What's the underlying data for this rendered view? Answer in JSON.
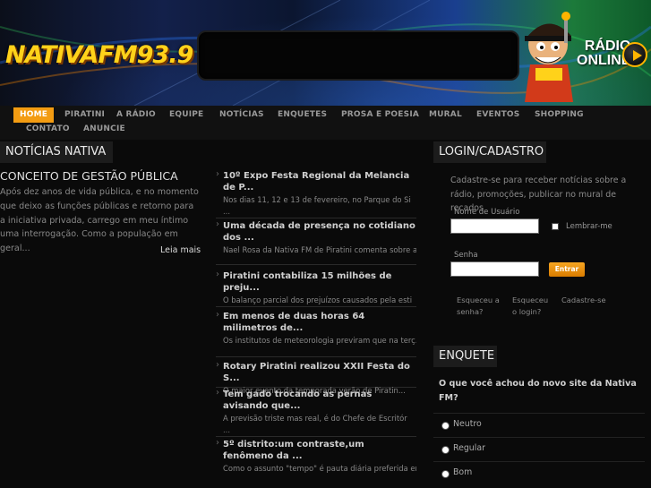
{
  "header": {
    "logo_text": "NATIVAFM93.9",
    "radio_online_line1": "RÁDIO",
    "radio_online_line2": "ONLINE"
  },
  "nav": {
    "items": [
      "HOME",
      "PIRATINI",
      "A RÁDIO",
      "EQUIPE",
      "NOTÍCIAS",
      "ENQUETES",
      "PROSA E POESIA",
      "MURAL",
      "EVENTOS",
      "SHOPPING",
      "CONTATO",
      "ANUNCIE"
    ],
    "active": "HOME"
  },
  "noticias": {
    "section_title": "NOTÍCIAS NATIVA",
    "featured": {
      "title": "CONCEITO DE GESTÃO PÚBLICA",
      "text": "Após dez anos de vida pública, e no momento que deixo as funções públicas e retorno para a iniciativa privada, carrego em meu íntimo uma interrogação. Como a população em geral...",
      "read_more": "Leia mais"
    },
    "items": [
      {
        "title": "10º Expo Festa Regional da Melancia de P...",
        "snippet": "Nos dias 11, 12 e 13 de fevereiro, no Parque do Si",
        "ellipsis": "..."
      },
      {
        "title": "Uma década de presença no cotidiano dos ...",
        "snippet": "Nael Rosa da Nativa FM de Piratini comenta sobre a...",
        "ellipsis": ""
      },
      {
        "title": "Piratini contabiliza 15 milhões de preju...",
        "snippet": "O balanço parcial dos prejuízos causados pela esti",
        "ellipsis": "..."
      },
      {
        "title": "Em menos de duas horas 64 milimetros de...",
        "snippet": "Os institutos de meteorologia previram que na terç...",
        "ellipsis": ""
      },
      {
        "title": "Rotary Piratini realizou XXII Festa do S...",
        "snippet": "O  maior evento da temporada verão de Piratin...",
        "ellipsis": ""
      },
      {
        "title": "Tem gado trocando as pernas avisando que...",
        "snippet": "A previsão triste mas real, é do Chefe de Escritór",
        "ellipsis": "..."
      },
      {
        "title": "5º distrito:um contraste,um fenômeno da ...",
        "snippet": "Como o assunto \"tempo\" é pauta diária preferida ent...",
        "ellipsis": ""
      }
    ]
  },
  "login": {
    "section_title": "LOGIN/CADASTRO",
    "intro": "Cadastre-se para receber notícias sobre a rádio, promoções, publicar no mural de recados",
    "username_label": "Nome de Usuário",
    "remember_label": "Lembrar-me",
    "password_label": "Senha",
    "submit_label": "Entrar",
    "forgot_password": "Esqueceu a senha?",
    "forgot_login": "Esqueceu o login?",
    "register": "Cadastre-se"
  },
  "enquete": {
    "section_title": "ENQUETE",
    "question": "O que você achou do novo site da Nativa FM?",
    "options": [
      "Neutro",
      "Regular",
      "Bom"
    ]
  }
}
